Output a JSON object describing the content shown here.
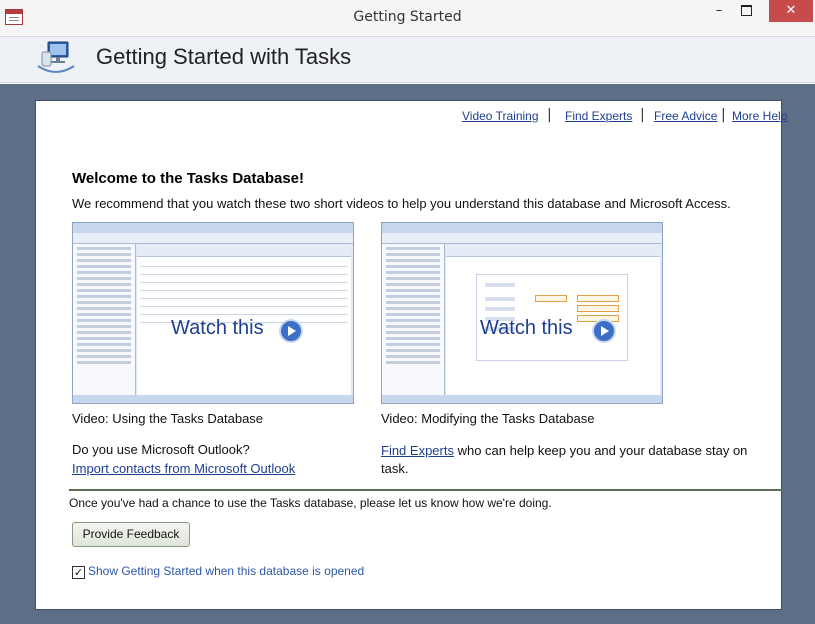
{
  "window": {
    "title": "Getting Started",
    "minimize_glyph": "–",
    "close_glyph": "✕"
  },
  "header": {
    "title": "Getting Started with Tasks",
    "icon": "tasks-app-icon"
  },
  "links": {
    "video_training": "Video Training",
    "find_experts": "Find Experts",
    "free_advice": "Free Advice",
    "more_help": "More Help",
    "separator": "|"
  },
  "welcome": {
    "heading": "Welcome to the Tasks Database!",
    "intro": "We recommend that you watch these two short videos to help you understand this database and Microsoft Access."
  },
  "videos": [
    {
      "overlay": "Watch this",
      "caption": "Video: Using the Tasks Database"
    },
    {
      "overlay": "Watch this",
      "caption": "Video: Modifying the Tasks Database"
    }
  ],
  "outlook": {
    "question": "Do you use Microsoft Outlook?",
    "link": "Import contacts from Microsoft Outlook"
  },
  "experts": {
    "link": "Find Experts",
    "text": " who can help keep you and your database stay on task."
  },
  "feedback": {
    "note": "Once you've had a chance to use the Tasks database, please let us know how we're doing.",
    "button": "Provide Feedback"
  },
  "startup": {
    "label": "Show Getting Started when this database is opened",
    "checked": true,
    "check_glyph": "✓"
  },
  "colors": {
    "frame": "#5d6f86",
    "link": "#1f3f8f",
    "checkbox_label": "#2e57a6",
    "close_button": "#c74b4b"
  }
}
